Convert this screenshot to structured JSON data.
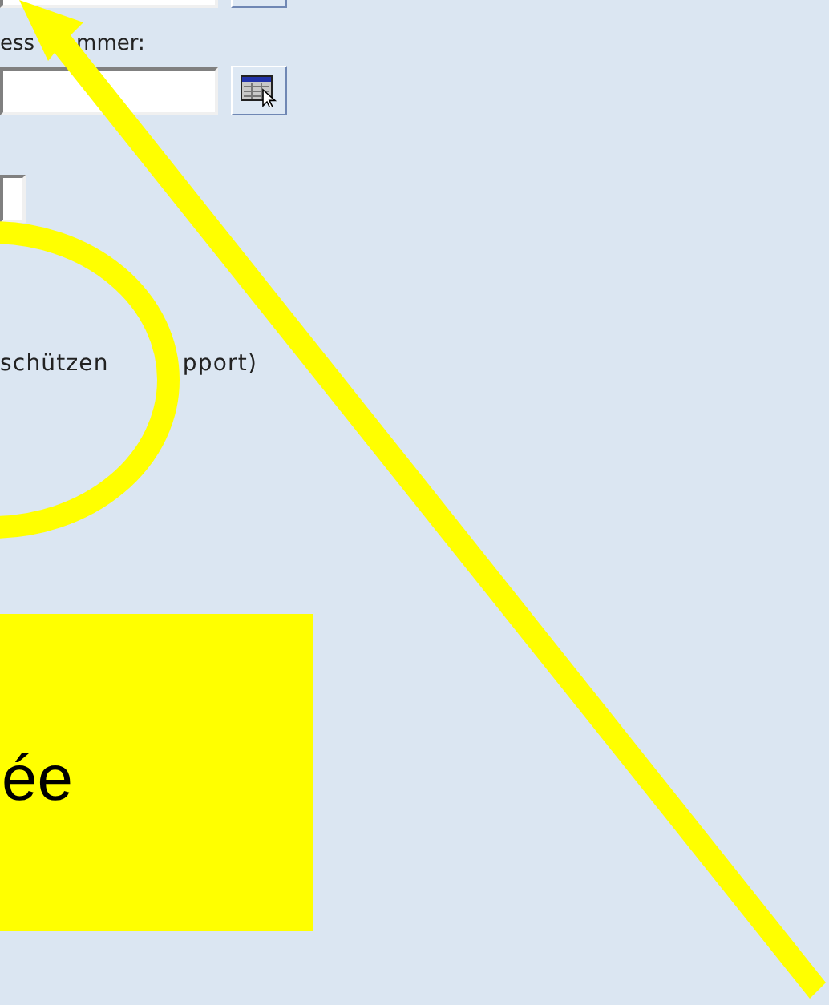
{
  "form": {
    "number_label": {
      "parts": [
        "ess",
        "mmer:"
      ]
    },
    "note": {
      "parts": [
        "schützen",
        "pport)"
      ]
    }
  },
  "callout": {
    "text": "ée"
  }
}
